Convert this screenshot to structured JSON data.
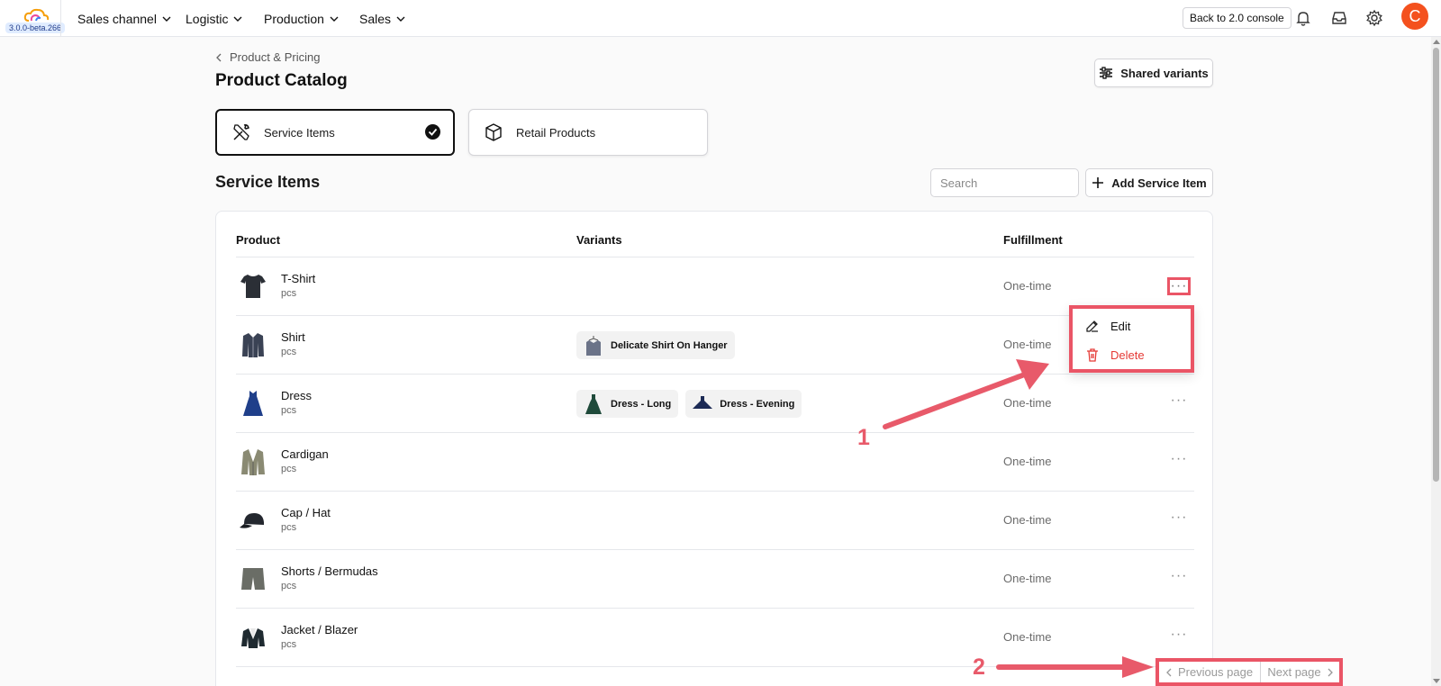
{
  "app": {
    "version": "3.0.0-beta.266",
    "brand_colors": {
      "primary": "#111111",
      "avatar": "#f4511e",
      "annotation": "#ea5566",
      "danger": "#e53935"
    }
  },
  "topnav": {
    "items": [
      {
        "label": "Sales channel",
        "icon": "chevron-down-icon"
      },
      {
        "label": "Logistic",
        "icon": "chevron-down-icon"
      },
      {
        "label": "Production",
        "icon": "chevron-down-icon"
      },
      {
        "label": "Sales",
        "icon": "chevron-down-icon"
      }
    ],
    "back_button": "Back to 2.0 console",
    "icons": [
      "bell-icon",
      "inbox-icon",
      "gear-icon"
    ],
    "avatar_initial": "C"
  },
  "header": {
    "breadcrumb": "Product & Pricing",
    "title": "Product Catalog",
    "shared_variants_label": "Shared variants"
  },
  "tabs": [
    {
      "label": "Service Items",
      "icon": "tools-icon",
      "selected": true
    },
    {
      "label": "Retail Products",
      "icon": "box-icon",
      "selected": false
    }
  ],
  "section": {
    "title": "Service Items",
    "search_placeholder": "Search",
    "add_label": "Add Service Item"
  },
  "table": {
    "columns": [
      "Product",
      "Variants",
      "Fulfillment"
    ],
    "rows": [
      {
        "name": "T-Shirt",
        "unit": "pcs",
        "variants": [],
        "fulfillment": "One-time",
        "image": "tshirt"
      },
      {
        "name": "Shirt",
        "unit": "pcs",
        "variants": [
          "Delicate Shirt On Hanger"
        ],
        "fulfillment": "One-time",
        "image": "shirt"
      },
      {
        "name": "Dress",
        "unit": "pcs",
        "variants": [
          "Dress - Long",
          "Dress - Evening"
        ],
        "fulfillment": "One-time",
        "image": "dress"
      },
      {
        "name": "Cardigan",
        "unit": "pcs",
        "variants": [],
        "fulfillment": "One-time",
        "image": "cardigan"
      },
      {
        "name": "Cap / Hat",
        "unit": "pcs",
        "variants": [],
        "fulfillment": "One-time",
        "image": "cap"
      },
      {
        "name": "Shorts / Bermudas",
        "unit": "pcs",
        "variants": [],
        "fulfillment": "One-time",
        "image": "shorts"
      },
      {
        "name": "Jacket / Blazer",
        "unit": "pcs",
        "variants": [],
        "fulfillment": "One-time",
        "image": "jacket"
      }
    ]
  },
  "row_menu": {
    "edit": "Edit",
    "delete": "Delete"
  },
  "annotations": {
    "one": "1",
    "two": "2"
  },
  "pagination": {
    "previous": "Previous page",
    "next": "Next page"
  }
}
